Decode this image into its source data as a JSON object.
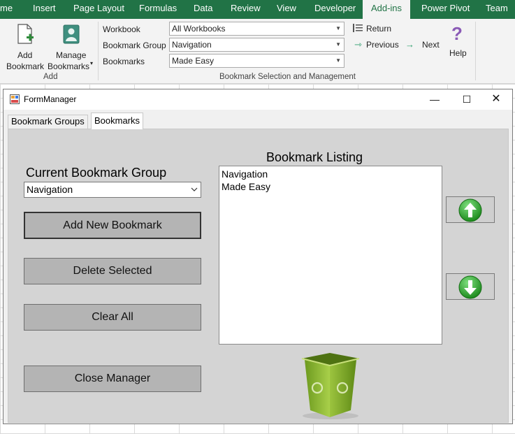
{
  "ribbon_tabs": {
    "home": "me",
    "insert": "Insert",
    "page_layout": "Page Layout",
    "formulas": "Formulas",
    "data": "Data",
    "review": "Review",
    "view": "View",
    "developer": "Developer",
    "addins": "Add-ins",
    "power_pivot": "Power Pivot",
    "team": "Team"
  },
  "ribbon": {
    "add_group": {
      "add_bookmark_line1": "Add",
      "add_bookmark_line2": "Bookmark",
      "manage_line1": "Manage",
      "manage_line2": "Bookmarks",
      "label": "Add"
    },
    "selection_group": {
      "workbook_label": "Workbook",
      "workbook_value": "All Workbooks",
      "group_label": "Bookmark Group",
      "group_value": "Navigation",
      "bookmarks_label": "Bookmarks",
      "bookmarks_value": "Made Easy",
      "return_label": "Return",
      "previous_label": "Previous",
      "next_label": "Next",
      "help_label": "Help",
      "label": "Bookmark Selection and Management"
    }
  },
  "window": {
    "title": "FormManager",
    "tabs": [
      "Bookmark Groups",
      "Bookmarks"
    ],
    "current_group_heading": "Current Bookmark Group",
    "current_group_value": "Navigation",
    "listing_heading": "Bookmark Listing",
    "listing_items": [
      "Navigation",
      "Made Easy"
    ],
    "buttons": {
      "add_new": "Add New Bookmark",
      "delete_selected": "Delete Selected",
      "clear_all": "Clear All",
      "close_manager": "Close Manager"
    }
  },
  "colors": {
    "excel_green": "#217346",
    "arrow_green": "#2e9e2e",
    "trash_green": "#8db83a"
  },
  "icons": {
    "add_bookmark": "page-plus-icon",
    "manage_bookmarks": "person-card-icon",
    "return": "list-return-icon",
    "previous": "arrow-left-icon",
    "next": "arrow-right-icon",
    "help": "question-mark-icon",
    "move_up": "up-arrow-icon",
    "move_down": "down-arrow-icon",
    "trash": "recycle-bin-icon"
  }
}
